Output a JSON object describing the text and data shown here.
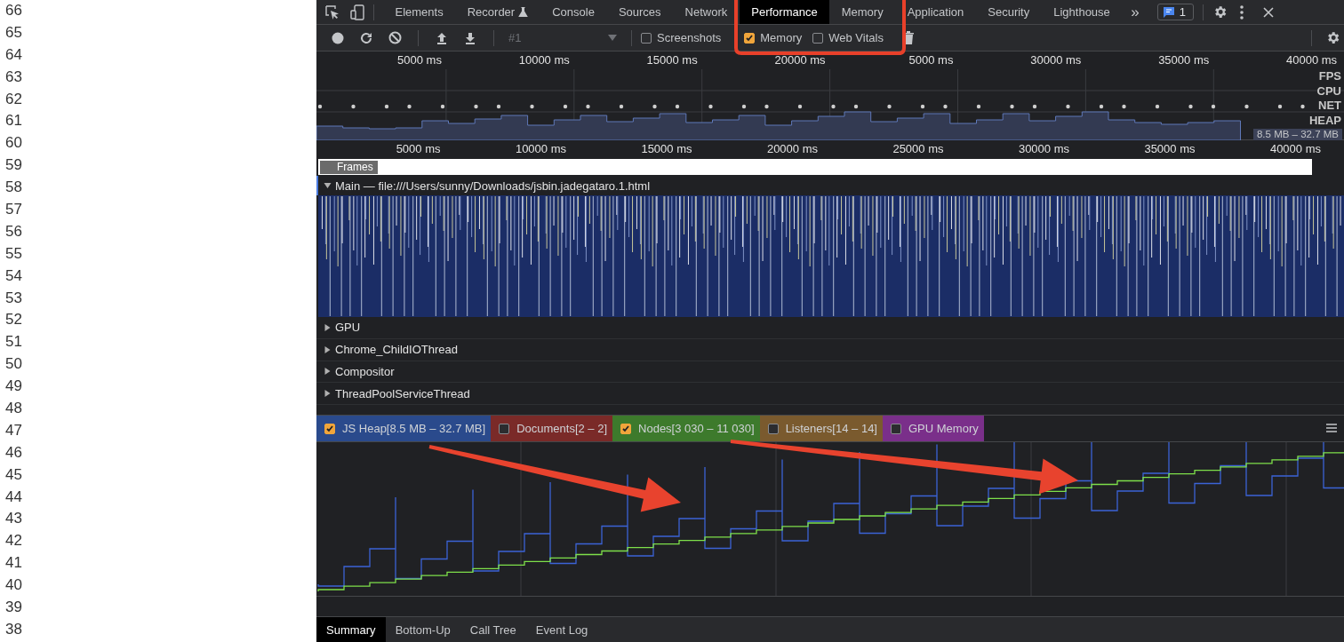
{
  "line_numbers": [
    "66",
    "65",
    "64",
    "63",
    "62",
    "61",
    "60",
    "59",
    "58",
    "57",
    "56",
    "55",
    "54",
    "53",
    "52",
    "51",
    "50",
    "49",
    "48",
    "47",
    "46",
    "45",
    "44",
    "43",
    "42",
    "41",
    "40",
    "39",
    "38"
  ],
  "devtools": {
    "tabs": [
      {
        "label": "Elements",
        "kind": "plain",
        "selected": false
      },
      {
        "label": "Recorder",
        "kind": "experiment",
        "selected": false
      },
      {
        "label": "Console",
        "kind": "plain",
        "selected": false
      },
      {
        "label": "Sources",
        "kind": "plain",
        "selected": false
      },
      {
        "label": "Network",
        "kind": "plain",
        "selected": false
      },
      {
        "label": "Performance",
        "kind": "plain",
        "selected": true
      },
      {
        "label": "Memory",
        "kind": "plain",
        "selected": false
      },
      {
        "label": "Application",
        "kind": "plain",
        "selected": false
      },
      {
        "label": "Security",
        "kind": "plain",
        "selected": false
      },
      {
        "label": "Lighthouse",
        "kind": "plain",
        "selected": false
      }
    ],
    "more_tabs": "»",
    "issues_count": "1",
    "toolbar": {
      "recording": "#1",
      "options": [
        {
          "label": "Screenshots",
          "checked": false
        },
        {
          "label": "Memory",
          "checked": true
        },
        {
          "label": "Web Vitals",
          "checked": false
        }
      ]
    },
    "overview": {
      "ticks": [
        "5000 ms",
        "10000 ms",
        "15000 ms",
        "20000 ms",
        "5000 ms",
        "30000 ms",
        "35000 ms",
        "40000 ms"
      ],
      "lanes": [
        "FPS",
        "CPU",
        "NET",
        "HEAP"
      ],
      "heap_range": "8.5 MB – 32.7 MB"
    },
    "ruler": [
      "5000 ms",
      "10000 ms",
      "15000 ms",
      "20000 ms",
      "25000 ms",
      "30000 ms",
      "35000 ms",
      "40000 ms"
    ],
    "frames_label": "Frames",
    "main_track": {
      "label": "Main — file:///Users/sunny/Downloads/jsbin.jadegataro.1.html",
      "expanded": true
    },
    "threads": [
      {
        "label": "GPU",
        "expanded": false
      },
      {
        "label": "Chrome_ChildIOThread",
        "expanded": false
      },
      {
        "label": "Compositor",
        "expanded": false
      },
      {
        "label": "ThreadPoolServiceThread",
        "expanded": false
      }
    ],
    "counters": [
      {
        "label": "JS Heap[8.5 MB – 32.7 MB]",
        "checked": true,
        "color": "#2a4a8c"
      },
      {
        "label": "Documents[2 – 2]",
        "checked": false,
        "color": "#7a2a28"
      },
      {
        "label": "Nodes[3 030 – 11 030]",
        "checked": true,
        "color": "#3d7a2c"
      },
      {
        "label": "Listeners[14 – 14]",
        "checked": false,
        "color": "#7a5a2e"
      },
      {
        "label": "GPU Memory",
        "checked": false,
        "color": "#7a2f8a"
      }
    ],
    "bottom_tabs": [
      {
        "label": "Summary",
        "selected": true
      },
      {
        "label": "Bottom-Up",
        "selected": false
      },
      {
        "label": "Call Tree",
        "selected": false
      },
      {
        "label": "Event Log",
        "selected": false
      }
    ]
  }
}
